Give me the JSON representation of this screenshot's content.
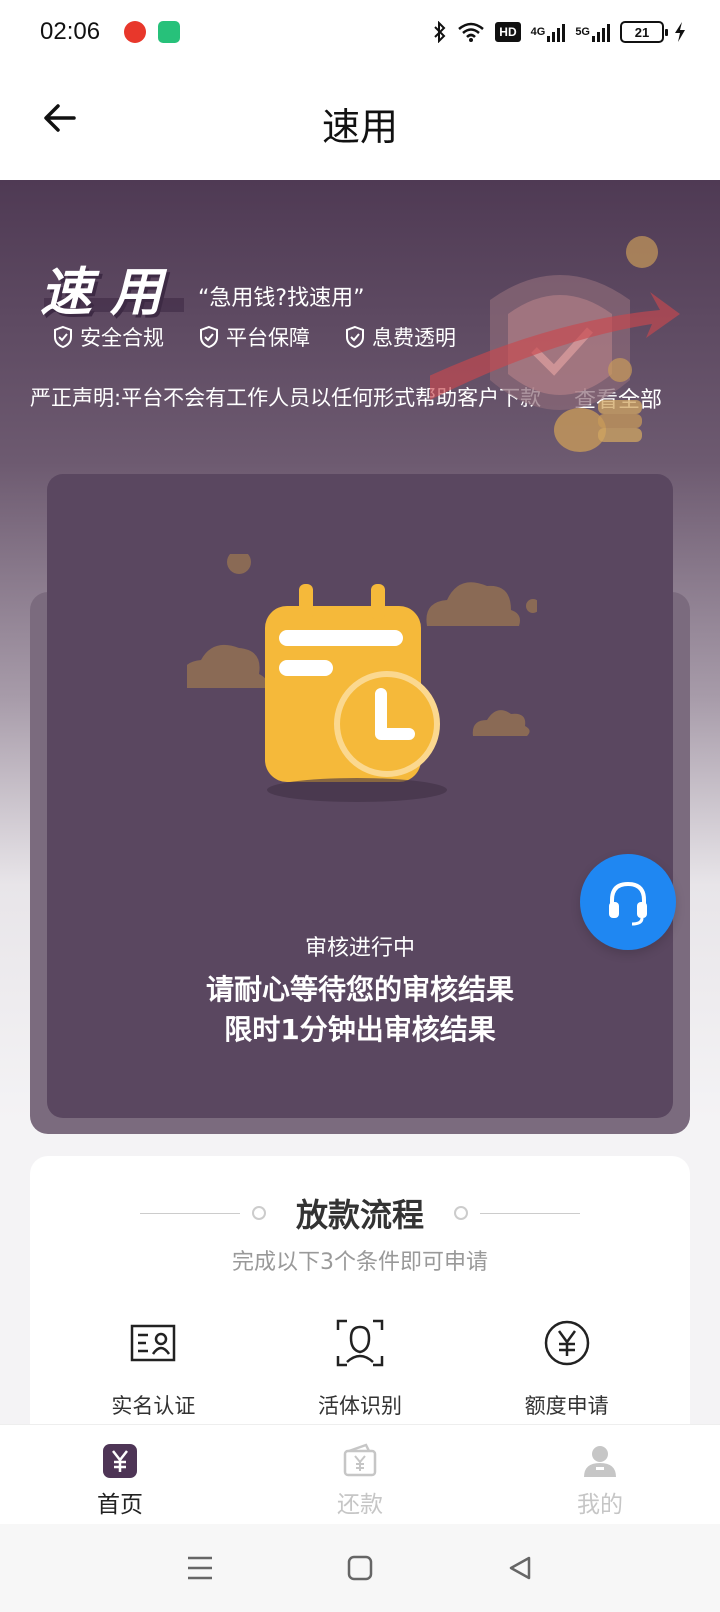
{
  "status_bar": {
    "time": "02:06",
    "hd_label": "HD",
    "network_a": "4G",
    "network_b": "5G",
    "battery_level": "21"
  },
  "header": {
    "title": "速用"
  },
  "hero": {
    "brand": "速用",
    "slogan": "“急用钱?找速用”",
    "features": [
      "安全合规",
      "平台保障",
      "息费透明"
    ],
    "notice": "严正声明:平台不会有工作人员以任何形式帮助客户下款",
    "view_all": "查看全部"
  },
  "status_card": {
    "status": "审核进行中",
    "message_line1": "请耐心等待您的审核结果",
    "message_line2": "限时1分钟出审核结果"
  },
  "process": {
    "title": "放款流程",
    "subtitle": "完成以下3个条件即可申请",
    "steps": [
      {
        "label": "实名认证",
        "icon": "id-card-icon"
      },
      {
        "label": "活体识别",
        "icon": "face-scan-icon"
      },
      {
        "label": "额度申请",
        "icon": "yuan-circle-icon"
      }
    ]
  },
  "bottom_nav": {
    "items": [
      {
        "label": "首页",
        "active": true
      },
      {
        "label": "还款",
        "active": false
      },
      {
        "label": "我的",
        "active": false
      }
    ]
  },
  "colors": {
    "brand_purple": "#5a4760",
    "support_blue": "#1f87f2",
    "calendar_yellow": "#f5b93a"
  }
}
